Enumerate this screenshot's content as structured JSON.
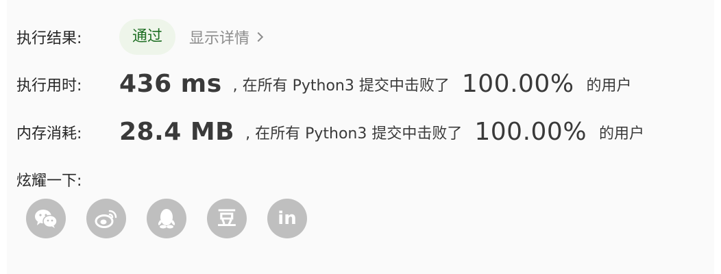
{
  "result": {
    "label": "执行结果:",
    "status": "通过",
    "details_link": "显示详情"
  },
  "runtime": {
    "label": "执行用时:",
    "value": "436 ms",
    "prefix": ", 在所有 Python3 提交中击败了",
    "percent": "100.00%",
    "suffix": "的用户"
  },
  "memory": {
    "label": "内存消耗:",
    "value": "28.4 MB",
    "prefix": ", 在所有 Python3 提交中击败了",
    "percent": "100.00%",
    "suffix": "的用户"
  },
  "share": {
    "label": "炫耀一下:",
    "buttons": [
      {
        "icon": "wechat-icon"
      },
      {
        "icon": "weibo-icon"
      },
      {
        "icon": "qq-icon"
      },
      {
        "icon": "douban-icon",
        "glyph": "豆"
      },
      {
        "icon": "linkedin-icon",
        "glyph": "in"
      }
    ]
  },
  "colors": {
    "badge_bg": "#eef5ea",
    "badge_text": "#1e6e23",
    "share_icon_bg": "#bfbfbf"
  }
}
